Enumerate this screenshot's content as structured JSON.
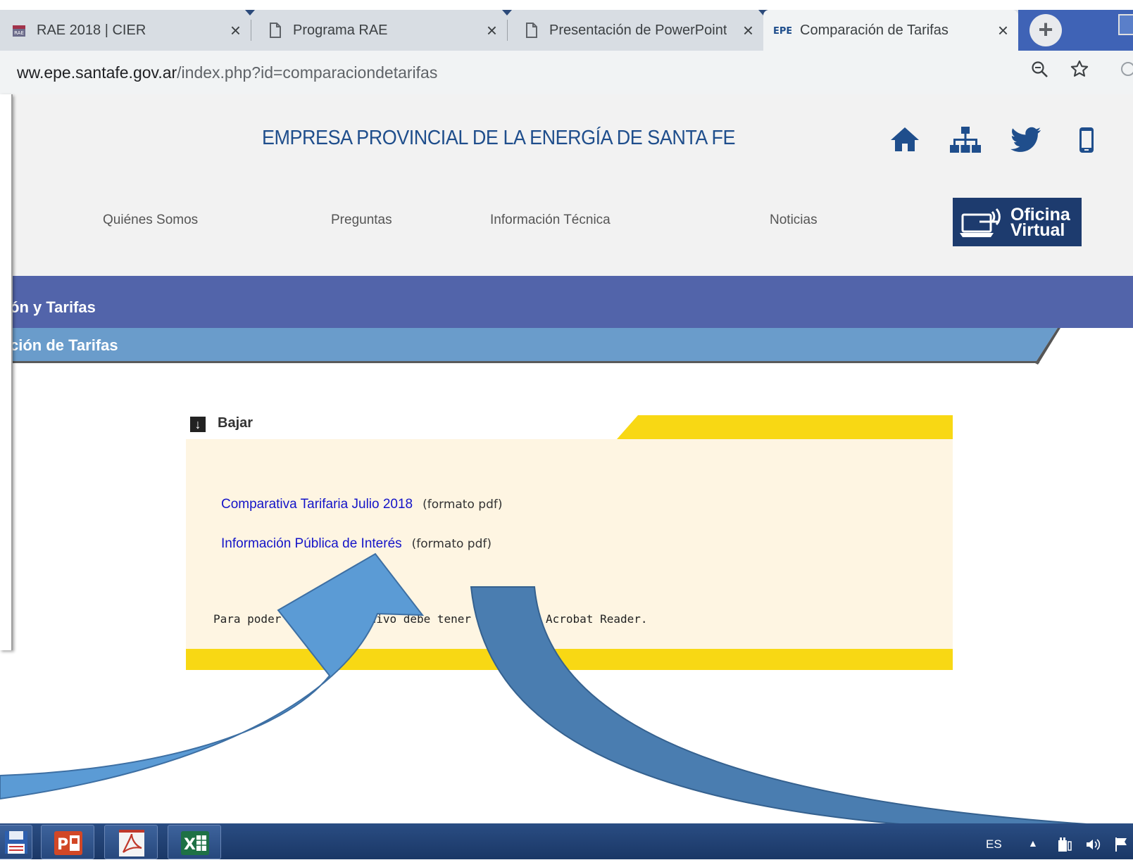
{
  "browser": {
    "tabs": [
      {
        "title": "RAE 2018 | CIER",
        "icon": "calendar-favicon"
      },
      {
        "title": "Programa RAE",
        "icon": "document-favicon"
      },
      {
        "title": "Presentación de PowerPoint",
        "icon": "document-favicon"
      },
      {
        "title": "Comparación de Tarifas",
        "icon": "epe-favicon",
        "active": true
      }
    ],
    "close_glyph": "×",
    "new_tab_glyph": "+",
    "url": {
      "host": "ww.epe.santafe.gov.ar",
      "path": "/index.php?id=comparaciondetarifas"
    },
    "icons": [
      "zoom-icon",
      "star-icon"
    ]
  },
  "site": {
    "title": "EMPRESA PROVINCIAL DE LA ENERGÍA DE SANTA FE",
    "header_icons": [
      "home-icon",
      "sitemap-icon",
      "twitter-icon",
      "mobile-icon"
    ],
    "nav": [
      "Quiénes Somos",
      "Preguntas",
      "Información Técnica",
      "Noticias"
    ],
    "oficina": {
      "line1": "Oficina",
      "line2": "Virtual"
    },
    "colors": {
      "title": "#1f4e8c",
      "band_dark": "#5264aa",
      "band_light": "#6a9ccb",
      "panel": "#fef5e2",
      "accent_yellow": "#f8d814",
      "link": "#1414c8"
    }
  },
  "breadcrumb": {
    "level1": "ón y Tarifas",
    "level2": "ción de Tarifas"
  },
  "downloads": {
    "header": "Bajar",
    "items": [
      {
        "label": "Comparativa Tarifaria Julio 2018",
        "format": "(formato pdf)"
      },
      {
        "label": "Información Pública de Interés",
        "format": "(formato pdf)"
      }
    ],
    "note": "Para poder ver este archivo debe tener instalado Acrobat Reader."
  },
  "taskbar": {
    "apps": [
      "save-icon",
      "powerpoint-icon",
      "acrobat-icon",
      "excel-icon"
    ],
    "lang": "ES"
  }
}
